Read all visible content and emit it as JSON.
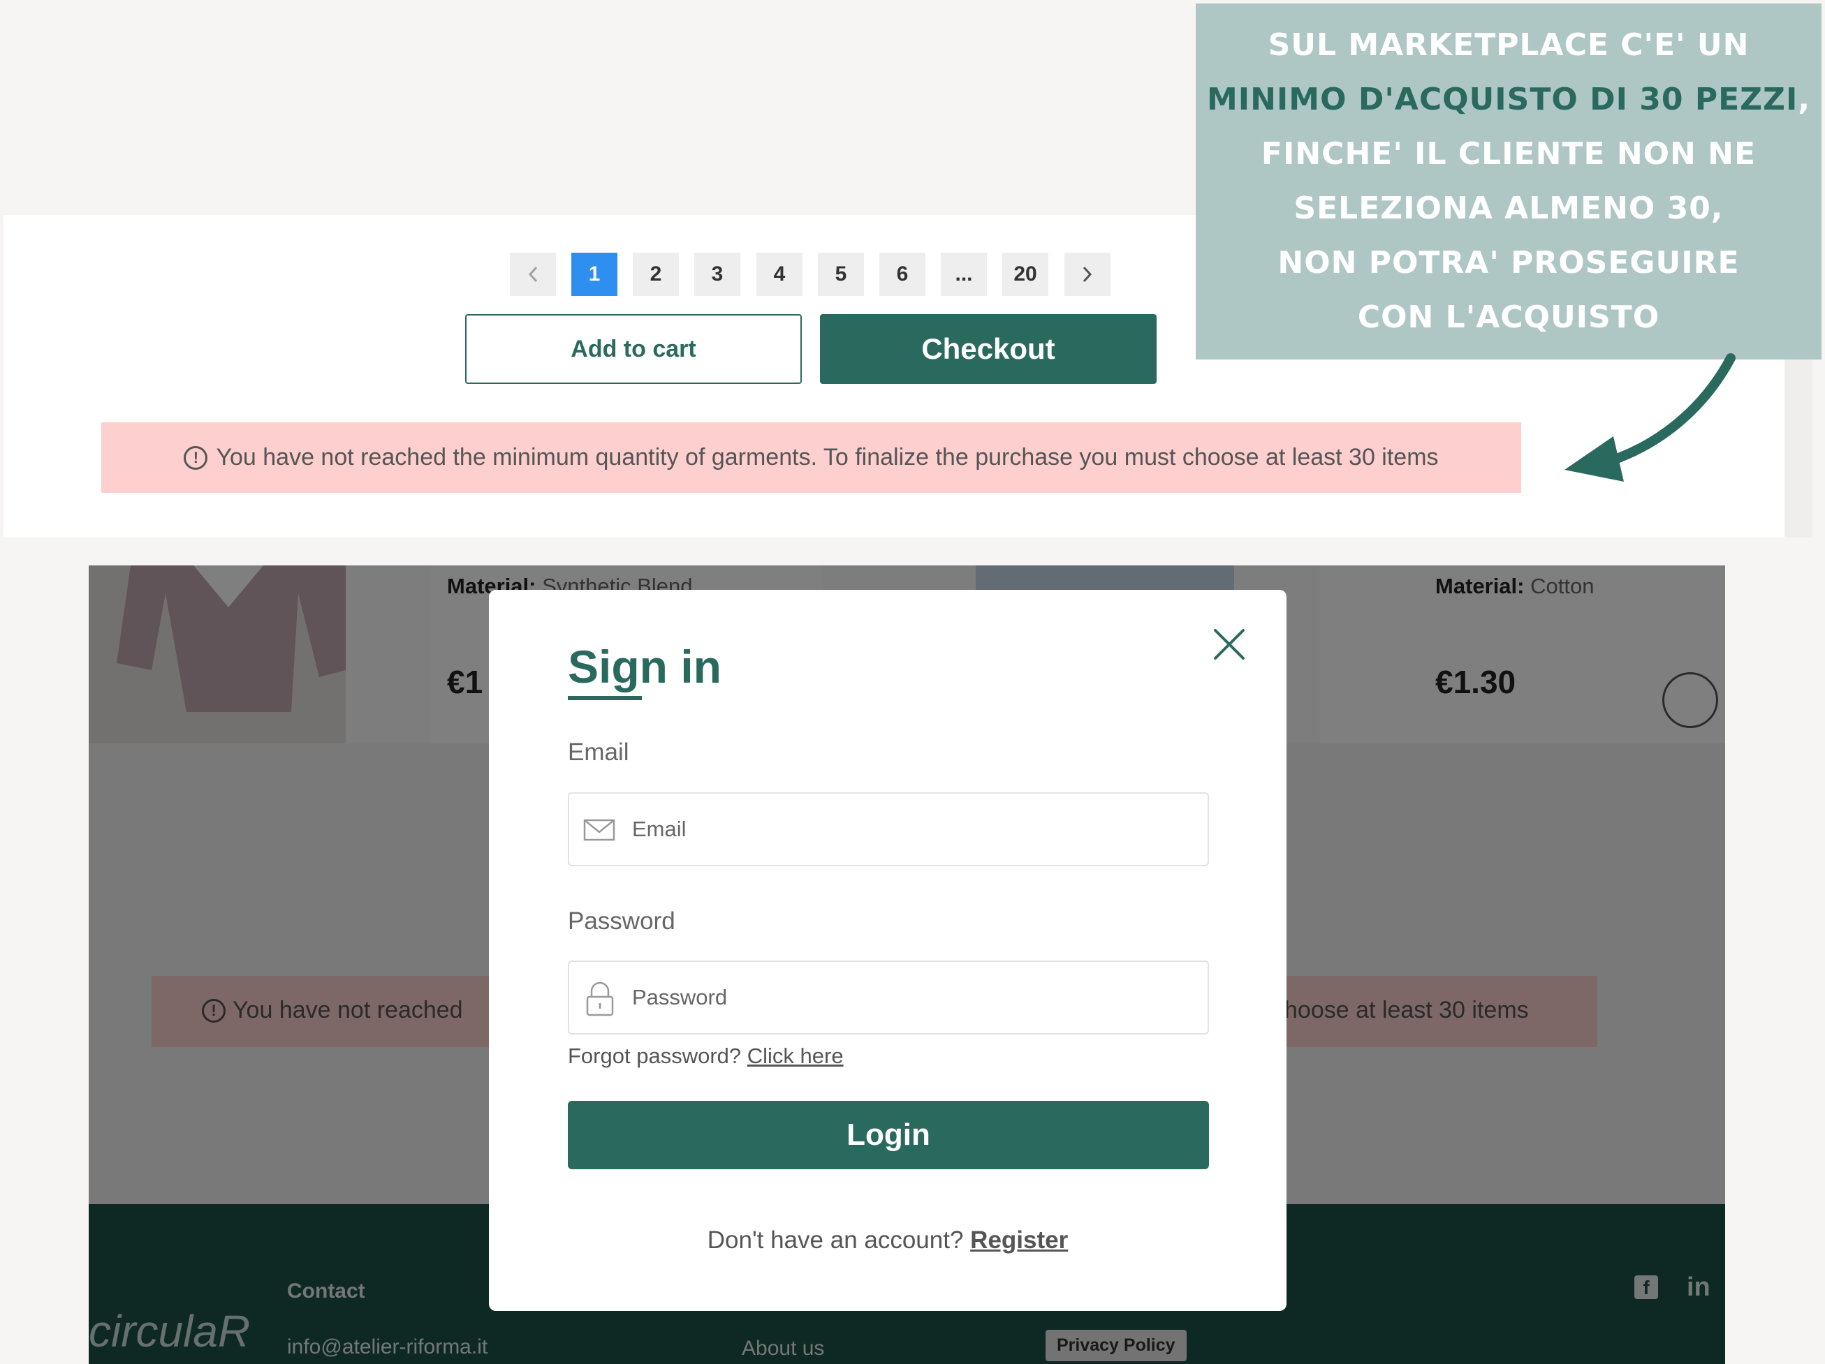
{
  "annotation": {
    "lines": [
      "SUL MARKETPLACE C'E' UN",
      "MINIMO D'ACQUISTO DI 30 PEZZI",
      "FINCHE' IL CLIENTE NON NE",
      "SELEZIONA ALMENO 30,",
      "NON POTRA' PROSEGUIRE",
      "CON L'ACQUISTO"
    ],
    "line2_comma": ",",
    "colors": {
      "box": "#aec7c4",
      "text": "#ffffff",
      "highlight": "#2a6a5e"
    }
  },
  "pagination": {
    "prev_icon": "chevron-left-icon",
    "pages": [
      "1",
      "2",
      "3",
      "4",
      "5",
      "6",
      "...",
      "20"
    ],
    "active_page": "1",
    "next_icon": "chevron-right-icon"
  },
  "actions": {
    "add_to_cart": "Add to cart",
    "checkout": "Checkout"
  },
  "warning": {
    "icon": "alert-circle-icon",
    "text": "You have not reached the minimum quantity of garments. To finalize the purchase you must choose at least 30 items"
  },
  "background": {
    "card1_material_label": "Material:",
    "card1_material_value": "Synthetic Blend",
    "card1_price": "€1",
    "card4_material_label": "Material:",
    "card4_material_value": "Cotton",
    "card4_price": "€1.30",
    "warning_left": "You have not reached",
    "warning_right": "hoose at least 30 items",
    "footer": {
      "logo": "circulaR",
      "contact_heading": "Contact",
      "email": "info@atelier-riforma.it",
      "about": "About us",
      "privacy": "Privacy Policy",
      "social_icons": [
        "facebook-icon",
        "linkedin-icon"
      ],
      "linkedin_label": "in"
    }
  },
  "modal": {
    "title": "Sign in",
    "close_icon": "close-icon",
    "email_label": "Email",
    "email_placeholder": "Email",
    "password_label": "Password",
    "password_placeholder": "Password",
    "forgot_text": "Forgot password?",
    "forgot_link": "Click here",
    "login_button": "Login",
    "no_account_text": "Don't have an account?",
    "register_link": "Register"
  },
  "colors": {
    "brand": "#2a6a5e",
    "active_page": "#2e8ff0",
    "warning_bg": "#fdcfcf",
    "footer": "#1d5249"
  }
}
